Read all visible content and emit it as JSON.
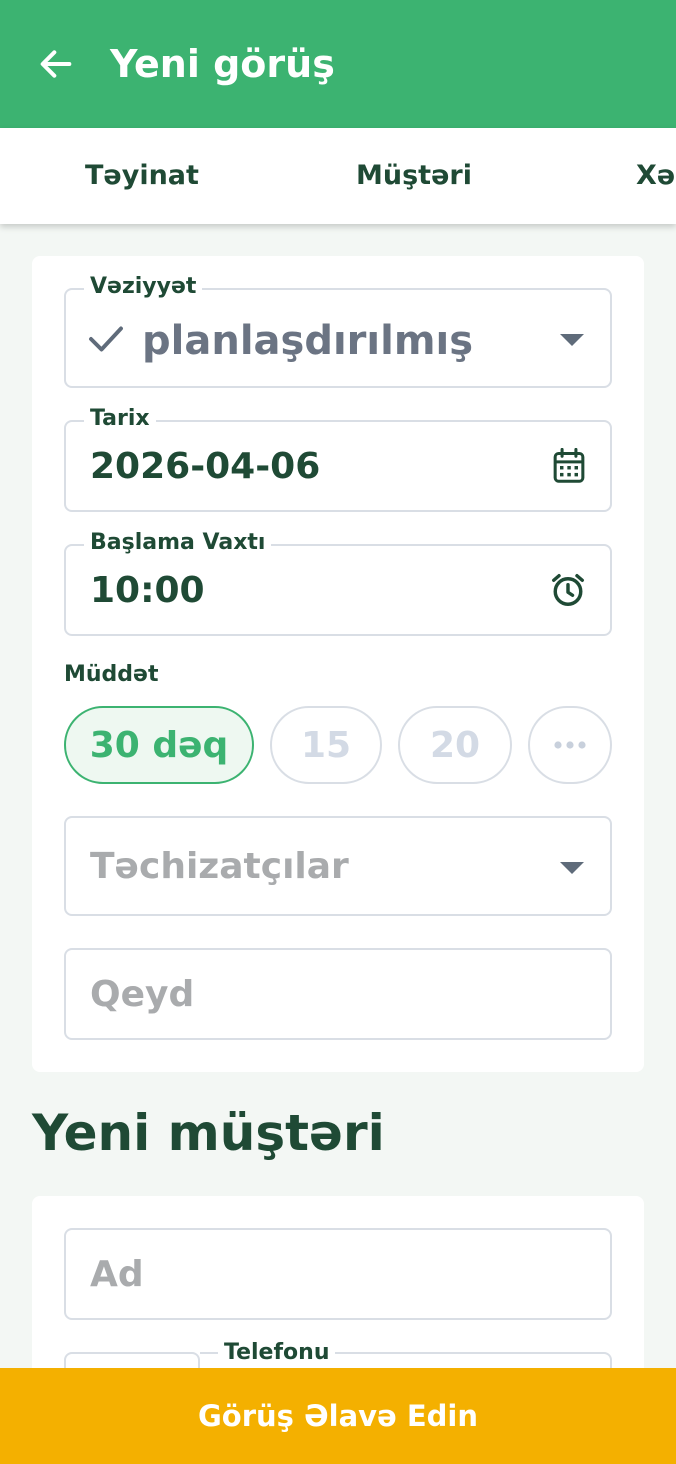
{
  "appbar": {
    "title": "Yeni görüş",
    "back_icon": "arrow-left-icon"
  },
  "tabs": [
    {
      "label": "Təyinat"
    },
    {
      "label": "Müştəri"
    },
    {
      "label": "Xəs"
    }
  ],
  "form": {
    "status": {
      "label": "Vəziyyət",
      "value": "planlaşdırılmış",
      "icon": "check-icon"
    },
    "date": {
      "label": "Tarix",
      "value": "2026-04-06",
      "icon": "calendar-icon"
    },
    "start_time": {
      "label": "Başlama Vaxtı",
      "value": "10:00",
      "icon": "alarm-clock-icon"
    },
    "duration": {
      "label": "Müddət",
      "options": [
        "30 dəq",
        "15",
        "20"
      ],
      "selected": "30 dəq",
      "more_icon": "more-horizontal-icon"
    },
    "suppliers": {
      "placeholder": "Təchizatçılar"
    },
    "note": {
      "placeholder": "Qeyd"
    }
  },
  "new_customer": {
    "title": "Yeni müştəri",
    "name": {
      "placeholder": "Ad"
    },
    "phone": {
      "label": "Telefonu"
    }
  },
  "submit": {
    "label": "Görüş Əlavə Edin"
  },
  "colors": {
    "primary": "#3cb371",
    "accent": "#f4b000",
    "text": "#1f4a35"
  }
}
